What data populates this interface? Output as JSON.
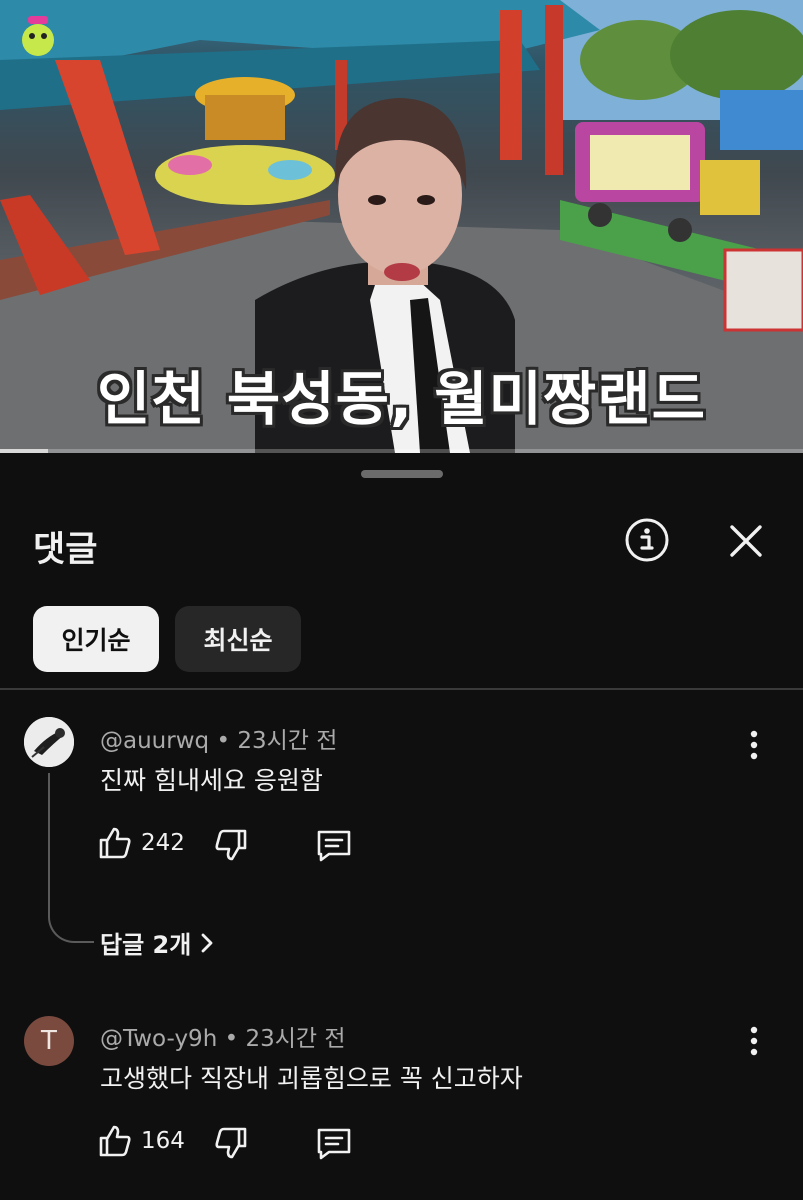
{
  "video": {
    "subtitle": "인천 북성동, 월미짱랜드",
    "progress": 0.06
  },
  "comments_panel": {
    "title": "댓글",
    "sort_chips": [
      {
        "label": "인기순",
        "active": true
      },
      {
        "label": "최신순",
        "active": false
      }
    ]
  },
  "comments": [
    {
      "author": "@auurwq",
      "time": "23시간 전",
      "text": "진짜 힘내세요 응원함",
      "likes": "242",
      "replies_label": "답글 2개"
    },
    {
      "author": "@Two-y9h",
      "avatar_letter": "T",
      "time": "23시간 전",
      "text": "고생했다 직장내 괴롭힘으로 꼭 신고하자",
      "likes": "164"
    }
  ],
  "icons": {
    "info": "info-icon",
    "close": "close-icon",
    "like": "thumbs-up-icon",
    "dislike": "thumbs-down-icon",
    "reply": "comment-icon",
    "more": "more-vert-icon",
    "chevron": "chevron-right-icon"
  },
  "colors": {
    "background": "#0f0f0f",
    "chip_active": "#f1f1f1",
    "chip_inactive": "#272727",
    "meta_text": "#aaaaaa",
    "avatar_t": "#7a4a3f"
  }
}
